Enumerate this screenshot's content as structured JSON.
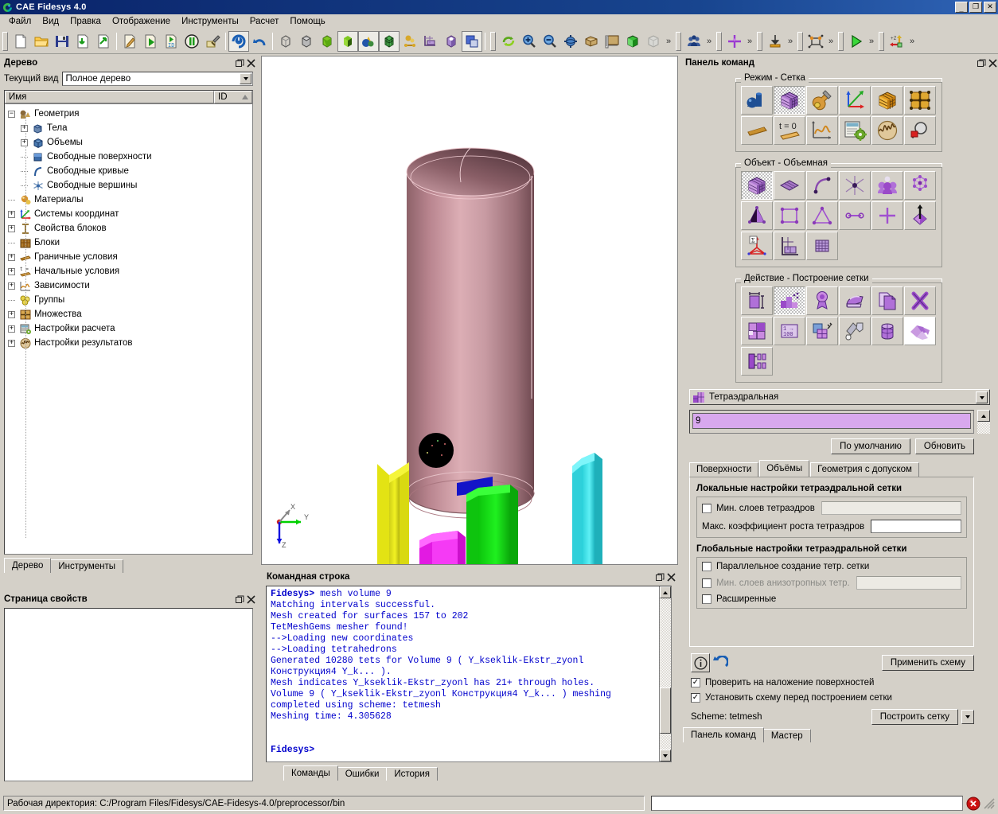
{
  "window": {
    "title": "CAE Fidesys 4.0",
    "logo_icon": "fidesys-logo-icon",
    "minimize_label": "_",
    "maximize_label": "□",
    "close_label": "✕"
  },
  "menu": {
    "items": [
      {
        "label": "Файл",
        "name": "menu-file"
      },
      {
        "label": "Вид",
        "name": "menu-view"
      },
      {
        "label": "Правка",
        "name": "menu-edit"
      },
      {
        "label": "Отображение",
        "name": "menu-display"
      },
      {
        "label": "Инструменты",
        "name": "menu-tools"
      },
      {
        "label": "Расчет",
        "name": "menu-analysis"
      },
      {
        "label": "Помощь",
        "name": "menu-help"
      }
    ]
  },
  "toolbar": {
    "overflow_label": "»",
    "groups": [
      {
        "name": "file-group",
        "buttons": [
          {
            "icon": "new-file-icon"
          },
          {
            "icon": "open-folder-icon"
          },
          {
            "icon": "save-icon"
          },
          {
            "icon": "import-icon"
          },
          {
            "icon": "export-icon"
          }
        ]
      },
      {
        "name": "journal-group",
        "buttons": [
          {
            "icon": "edit-journal-icon"
          },
          {
            "icon": "play-journal-icon"
          },
          {
            "icon": "play-id-icon"
          },
          {
            "icon": "pause-icon"
          },
          {
            "icon": "build-hammer-icon"
          }
        ]
      },
      {
        "name": "undo-group",
        "buttons": [
          {
            "icon": "power-reset-icon"
          },
          {
            "icon": "undo-arrow-icon"
          }
        ]
      },
      {
        "name": "display-mode-group",
        "buttons": [
          {
            "icon": "wireframe-cube-icon"
          },
          {
            "icon": "hidden-line-cube-icon"
          },
          {
            "icon": "smooth-shade-cube-icon"
          },
          {
            "icon": "flat-shade-cube-icon"
          },
          {
            "icon": "primitives-icon"
          },
          {
            "icon": "mesh-cube-icon"
          },
          {
            "icon": "composite-icon"
          },
          {
            "icon": "grid-lines-icon"
          },
          {
            "icon": "volume-light-icon"
          },
          {
            "icon": "overlay-icon"
          }
        ]
      },
      {
        "name": "view-group",
        "buttons": [
          {
            "icon": "refresh-icon"
          },
          {
            "icon": "zoom-in-icon"
          },
          {
            "icon": "zoom-out-icon"
          },
          {
            "icon": "rotate-view-icon"
          },
          {
            "icon": "perspective-box-icon"
          },
          {
            "icon": "ruler-icon"
          },
          {
            "icon": "green-cube-icon"
          },
          {
            "icon": "ghost-cube-icon"
          }
        ]
      },
      {
        "name": "groups-group",
        "buttons": [
          {
            "icon": "groups-people-icon"
          }
        ]
      },
      {
        "name": "crosshair-group",
        "buttons": [
          {
            "icon": "crosshair-purple-icon"
          }
        ]
      },
      {
        "name": "load-group",
        "buttons": [
          {
            "icon": "pressure-load-icon"
          }
        ]
      },
      {
        "name": "mesh-quality-group",
        "buttons": [
          {
            "icon": "node-element-icon"
          }
        ]
      },
      {
        "name": "run-group",
        "buttons": [
          {
            "icon": "run-play-icon"
          }
        ]
      },
      {
        "name": "axis-group",
        "buttons": [
          {
            "icon": "z-axis-icon"
          }
        ]
      }
    ]
  },
  "tree_panel": {
    "title": "Дерево",
    "float_icon": "restore-icon",
    "close_icon": "close-icon",
    "view_label": "Текущий вид",
    "view_value": "Полное дерево",
    "columns": {
      "name": "Имя",
      "id": "ID"
    },
    "items": [
      {
        "label": "Геометрия",
        "level": 0,
        "expander": "minus",
        "icon": "geometry-icon"
      },
      {
        "label": "Тела",
        "level": 1,
        "expander": "plus",
        "icon": "bodies-icon"
      },
      {
        "label": "Объемы",
        "level": 1,
        "expander": "plus",
        "icon": "volumes-icon"
      },
      {
        "label": "Свободные поверхности",
        "level": 1,
        "expander": "none",
        "icon": "free-surfaces-icon"
      },
      {
        "label": "Свободные кривые",
        "level": 1,
        "expander": "none",
        "icon": "free-curves-icon"
      },
      {
        "label": "Свободные вершины",
        "level": 1,
        "expander": "none",
        "icon": "free-vertices-icon"
      },
      {
        "label": "Материалы",
        "level": 0,
        "expander": "none",
        "icon": "materials-icon"
      },
      {
        "label": "Системы координат",
        "level": 0,
        "expander": "plus",
        "icon": "coordinate-systems-icon"
      },
      {
        "label": "Свойства блоков",
        "level": 0,
        "expander": "plus",
        "icon": "block-properties-icon"
      },
      {
        "label": "Блоки",
        "level": 0,
        "expander": "none",
        "icon": "blocks-icon"
      },
      {
        "label": "Граничные условия",
        "level": 0,
        "expander": "plus",
        "icon": "boundary-conditions-icon"
      },
      {
        "label": "Начальные условия",
        "level": 0,
        "expander": "plus",
        "icon": "initial-conditions-icon"
      },
      {
        "label": "Зависимости",
        "level": 0,
        "expander": "plus",
        "icon": "dependencies-icon"
      },
      {
        "label": "Группы",
        "level": 0,
        "expander": "none",
        "icon": "groups-icon"
      },
      {
        "label": "Множества",
        "level": 0,
        "expander": "plus",
        "icon": "sets-icon"
      },
      {
        "label": "Настройки расчета",
        "level": 0,
        "expander": "plus",
        "icon": "analysis-settings-icon"
      },
      {
        "label": "Настройки результатов",
        "level": 0,
        "expander": "plus",
        "icon": "result-settings-icon"
      }
    ],
    "tabs": [
      {
        "label": "Дерево",
        "active": true
      },
      {
        "label": "Инструменты",
        "active": false
      }
    ]
  },
  "properties_panel": {
    "title": "Страница свойств",
    "float_icon": "restore-icon",
    "close_icon": "close-icon",
    "content": ""
  },
  "viewport": {
    "triad": {
      "x": "X",
      "y": "Y",
      "z": "Z"
    },
    "model_color": "#c99aa3",
    "part_colors": [
      "#e8e81e",
      "#0000cc",
      "#00e000",
      "#ee00ee",
      "#33dddd"
    ]
  },
  "command_panel": {
    "title": "Панель команд",
    "float_icon": "restore-icon",
    "close_icon": "close-icon",
    "mode_group": {
      "legend": "Режим - Сетка",
      "buttons": [
        {
          "icon": "geometry-mode-icon",
          "selected": false
        },
        {
          "icon": "mesh-mode-icon",
          "selected": true
        },
        {
          "icon": "tools-mode-icon",
          "selected": false
        },
        {
          "icon": "axes-mode-icon",
          "selected": false
        },
        {
          "icon": "blocks-mode-icon",
          "selected": false
        },
        {
          "icon": "sets-mode-icon",
          "selected": false
        },
        {
          "icon": "bc-mode-icon",
          "selected": false
        },
        {
          "icon": "initial-cond-mode-icon",
          "selected": false
        },
        {
          "icon": "dependencies-mode-icon",
          "selected": false
        },
        {
          "icon": "calc-settings-mode-icon",
          "selected": false
        },
        {
          "icon": "results-mode-icon",
          "selected": false
        },
        {
          "icon": "inspect-mode-icon",
          "selected": false
        }
      ]
    },
    "object_group": {
      "legend": "Объект - Объемная",
      "buttons": [
        {
          "icon": "volume-object-icon",
          "selected": true
        },
        {
          "icon": "surface-object-icon",
          "selected": false
        },
        {
          "icon": "curve-object-icon",
          "selected": false
        },
        {
          "icon": "vertex-object-icon",
          "selected": false
        },
        {
          "icon": "group-object-icon",
          "selected": false
        },
        {
          "icon": "node-object-icon",
          "selected": false
        },
        {
          "icon": "tet-object-icon",
          "selected": false
        },
        {
          "icon": "quad-object-icon",
          "selected": false
        },
        {
          "icon": "tri-object-icon",
          "selected": false
        },
        {
          "icon": "edge-object-icon",
          "selected": false
        },
        {
          "icon": "node-cross-object-icon",
          "selected": false
        },
        {
          "icon": "arrow-object-icon",
          "selected": false
        },
        {
          "icon": "sigma-object-icon",
          "selected": false
        },
        {
          "icon": "scale-object-icon",
          "selected": false
        },
        {
          "icon": "grid-object-icon",
          "selected": false
        }
      ]
    },
    "action_group": {
      "legend": "Действие - Построение сетки",
      "buttons": [
        {
          "icon": "interval-action-icon",
          "selected": false
        },
        {
          "icon": "mesh-action-icon",
          "selected": true
        },
        {
          "icon": "quality-action-icon",
          "selected": false
        },
        {
          "icon": "smooth-action-icon",
          "selected": false
        },
        {
          "icon": "copy-mesh-action-icon",
          "selected": false
        },
        {
          "icon": "delete-mesh-action-icon",
          "selected": false
        },
        {
          "icon": "refine-action-icon",
          "selected": false
        },
        {
          "icon": "renumber-action-icon",
          "selected": false
        },
        {
          "icon": "merge-action-icon",
          "selected": false
        },
        {
          "icon": "paint-action-icon",
          "selected": false
        },
        {
          "icon": "sweep-action-icon",
          "selected": false
        },
        {
          "icon": "skin-action-icon",
          "selected": true
        },
        {
          "icon": "layers-action-icon",
          "selected": false
        }
      ]
    },
    "scheme": {
      "icon": "tetmesh-icon",
      "value": "Тетраэдральная",
      "dropdown_icon": "chevron-down-icon"
    },
    "entity_value": "9",
    "default_button": "По умолчанию",
    "update_button": "Обновить",
    "tabs": [
      {
        "label": "Поверхности",
        "active": false
      },
      {
        "label": "Объёмы",
        "active": true
      },
      {
        "label": "Геометрия с допуском",
        "active": false
      }
    ],
    "local_settings": {
      "header": "Локальные настройки тетраэдральной сетки",
      "min_layers": {
        "label": "Мин. слоев тетраэдров",
        "checked": false,
        "value": ""
      },
      "max_growth": {
        "label": "Макс. коэффициент роста тетраэдров",
        "value": ""
      }
    },
    "global_settings": {
      "header": "Глобальные настройки тетраэдральной сетки",
      "parallel": {
        "label": "Параллельное создание тетр. сетки",
        "checked": false
      },
      "min_aniso": {
        "label": "Мин. слоев анизотропных тетр.",
        "checked": false,
        "disabled": true,
        "value": ""
      },
      "advanced": {
        "label": "Расширенные",
        "checked": false
      }
    },
    "info_icon": "info-icon",
    "reset_icon": "reset-arrow-icon",
    "apply_scheme_button": "Применить схему",
    "check_overlap": {
      "label": "Проверить на наложение поверхностей",
      "checked": true
    },
    "set_scheme": {
      "label": "Установить схему перед построением сетки",
      "checked": true
    },
    "scheme_status": "Scheme: tetmesh",
    "build_mesh_button": "Построить сетку",
    "bottom_tabs": [
      {
        "label": "Панель команд",
        "active": true
      },
      {
        "label": "Мастер",
        "active": false
      }
    ]
  },
  "console": {
    "title": "Командная строка",
    "float_icon": "restore-icon",
    "close_icon": "close-icon",
    "prompt": "Fidesys>",
    "lines": [
      {
        "prompt": "Fidesys>",
        "text": " mesh volume 9"
      },
      {
        "prompt": "",
        "text": "Matching intervals successful."
      },
      {
        "prompt": "",
        "text": "Mesh created for surfaces 157 to 202"
      },
      {
        "prompt": "",
        "text": "TetMeshGems mesher found!"
      },
      {
        "prompt": "",
        "text": "-->Loading new coordinates"
      },
      {
        "prompt": "",
        "text": "-->Loading tetrahedrons"
      },
      {
        "prompt": "",
        "text": "Generated 10280 tets for Volume 9 ( Y_kseklik-Ekstr_zyonl"
      },
      {
        "prompt": "",
        "text": "Конструкция4 Y_k... )."
      },
      {
        "prompt": "",
        "text": "Mesh indicates Y_kseklik-Ekstr_zyonl has 21+ through holes."
      },
      {
        "prompt": "",
        "text": "Volume 9 ( Y_kseklik-Ekstr_zyonl Конструкция4 Y_k... ) meshing"
      },
      {
        "prompt": "",
        "text": "completed using scheme: tetmesh"
      },
      {
        "prompt": "",
        "text": "Meshing time: 4.305628"
      },
      {
        "prompt": "",
        "text": ""
      },
      {
        "prompt": "",
        "text": ""
      },
      {
        "prompt": "Fidesys>",
        "text": ""
      }
    ],
    "tabs": [
      {
        "label": "Команды",
        "active": true
      },
      {
        "label": "Ошибки",
        "active": false
      },
      {
        "label": "История",
        "active": false
      }
    ]
  },
  "statusbar": {
    "working_dir": "Рабочая директория: C:/Program Files/Fidesys/CAE-Fidesys-4.0/preprocessor/bin",
    "input_value": "",
    "stop_icon": "stop-error-icon"
  }
}
